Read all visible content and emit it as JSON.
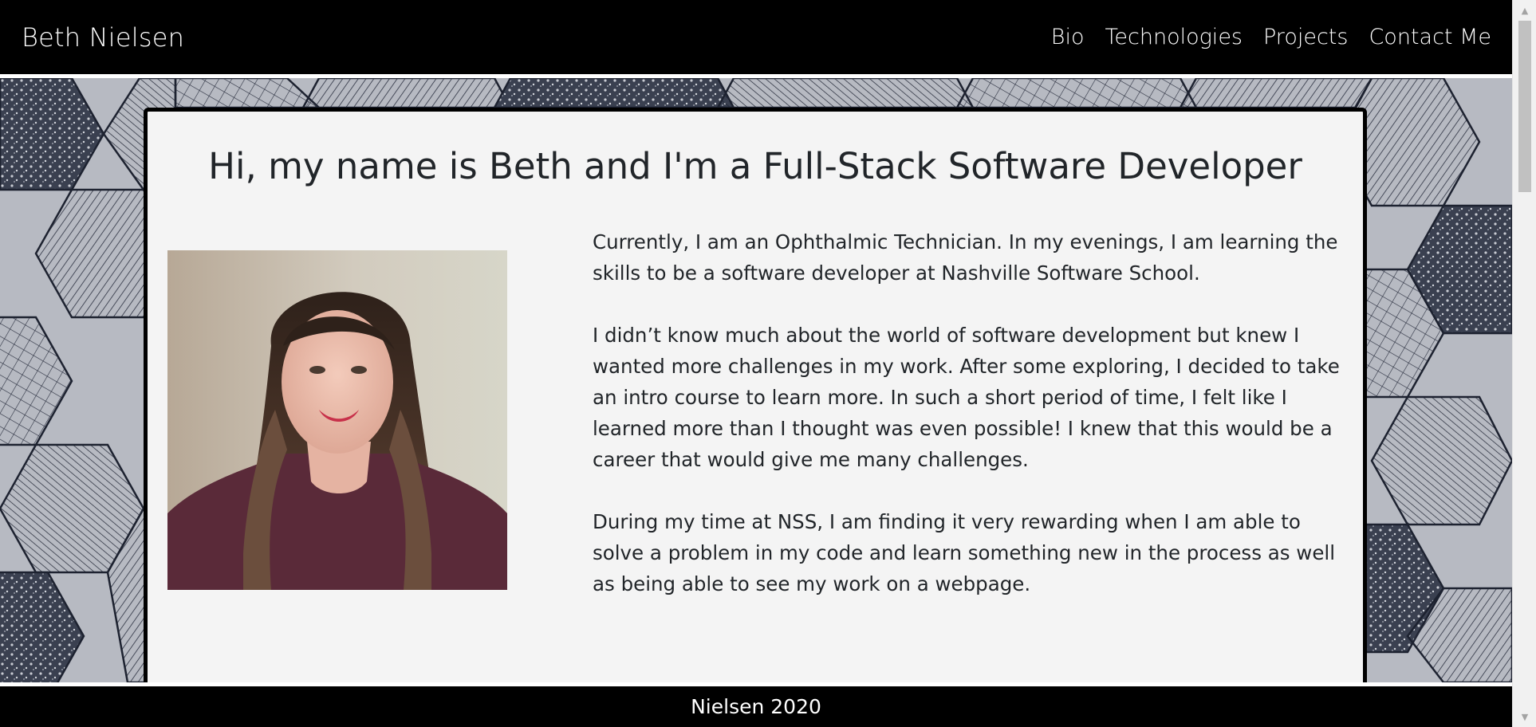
{
  "navbar": {
    "brand": "Beth Nielsen",
    "links": [
      "Bio",
      "Technologies",
      "Projects",
      "Contact Me"
    ]
  },
  "bio": {
    "title": "Hi, my name is Beth and I'm a Full-Stack Software Developer",
    "paragraphs": [
      "Currently, I am an Ophthalmic Technician. In my evenings, I am learning the skills to be a software developer at Nashville Software School.",
      "I didn’t know much about the world of software development but knew I wanted more challenges in my work. After some exploring, I decided to take an intro course to learn more. In such a short period of time, I felt like I learned more than I thought was even possible! I knew that this would be a career that would give me many challenges.",
      "During my time at NSS, I am finding it very rewarding when I am able to solve a problem in my code and learn something new in the process as well as being able to see my work on a webpage."
    ]
  },
  "footer": {
    "text": "Nielsen 2020"
  },
  "colors": {
    "nav_background": "#000000",
    "card_background": "#f4f4f4",
    "text": "#212529"
  }
}
